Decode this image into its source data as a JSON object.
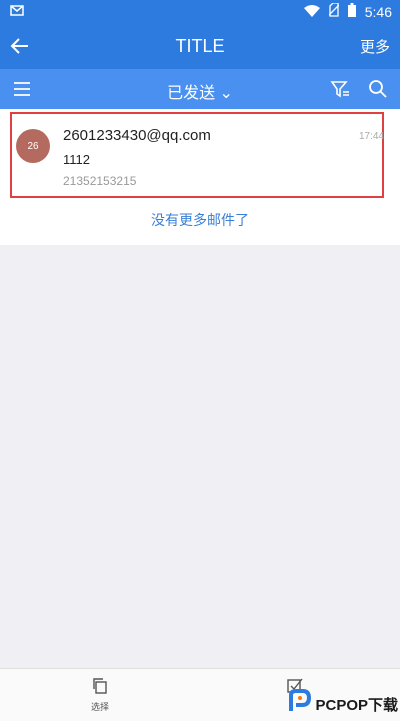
{
  "status": {
    "time": "5:46"
  },
  "header": {
    "title": "TITLE",
    "more": "更多"
  },
  "toolbar": {
    "folder": "已发送 ⌄"
  },
  "mail": {
    "avatar": "26",
    "from": "2601233430@qq.com",
    "subject": "1112",
    "preview": "21352153215",
    "time": "17:44"
  },
  "list": {
    "end_text": "没有更多邮件了"
  },
  "bottom": {
    "select_label": "选择"
  },
  "watermark": {
    "text": "PCPOP下载"
  },
  "colors": {
    "primary": "#2e7be0",
    "secondary": "#4a90f0",
    "highlight": "#e04040"
  }
}
